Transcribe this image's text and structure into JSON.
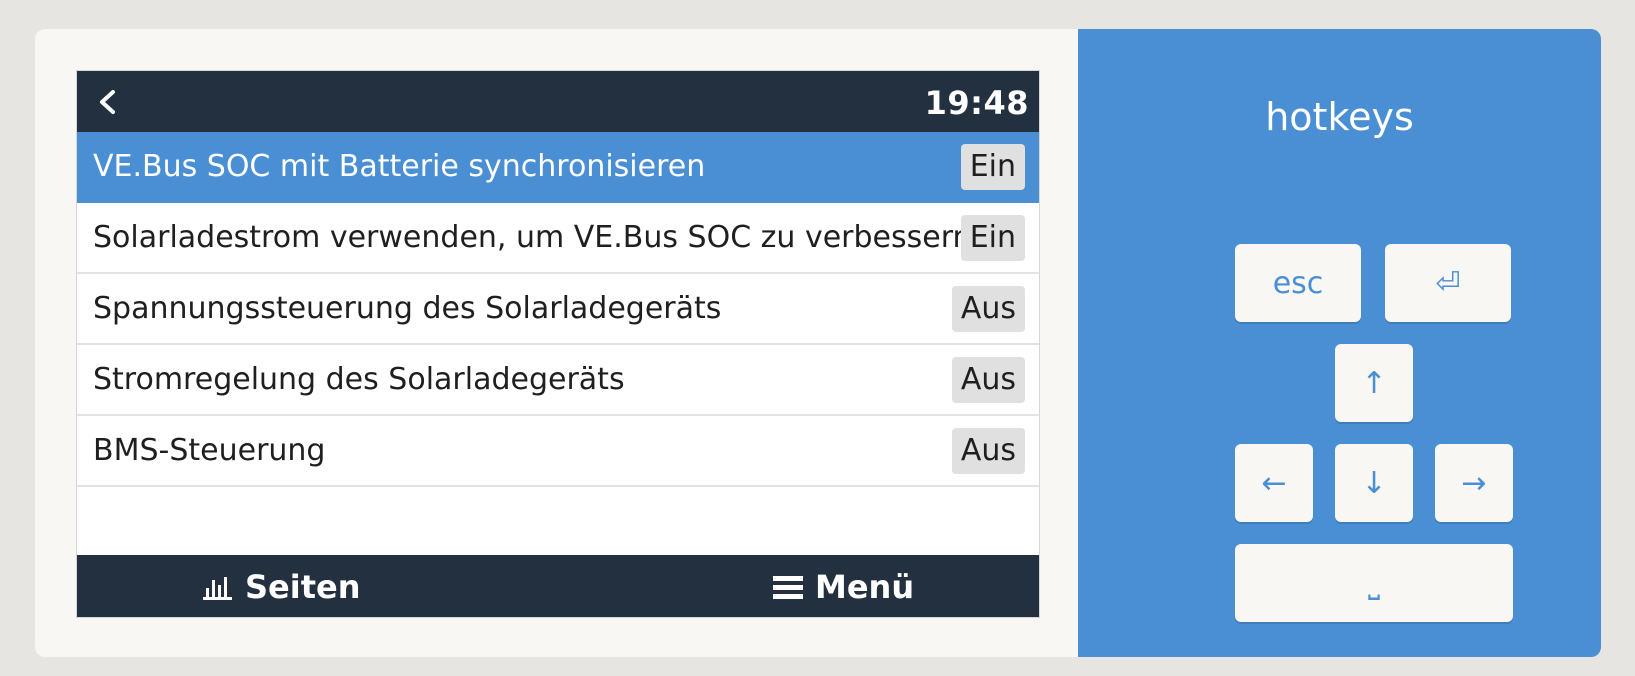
{
  "status_bar": {
    "time": "19:48"
  },
  "settings": [
    {
      "label": "VE.Bus SOC mit Batterie synchronisieren",
      "value": "Ein",
      "selected": true
    },
    {
      "label": "Solarladestrom verwenden, um VE.Bus SOC zu verbessern",
      "value": "Ein",
      "selected": false
    },
    {
      "label": "Spannungssteuerung des Solarladegeräts",
      "value": "Aus",
      "selected": false
    },
    {
      "label": "Stromregelung des Solarladegeräts",
      "value": "Aus",
      "selected": false
    },
    {
      "label": "BMS-Steuerung",
      "value": "Aus",
      "selected": false
    }
  ],
  "bottom_nav": {
    "pages_label": "Seiten",
    "menu_label": "Menü"
  },
  "hotkeys": {
    "title": "hotkeys",
    "esc_label": "esc",
    "enter_symbol": "⏎",
    "up_symbol": "↑",
    "left_symbol": "←",
    "down_symbol": "↓",
    "right_symbol": "→",
    "space_symbol": "⎵"
  },
  "colors": {
    "accent": "#4a8fd3",
    "bar": "#22303f",
    "card": "#f8f7f4"
  }
}
